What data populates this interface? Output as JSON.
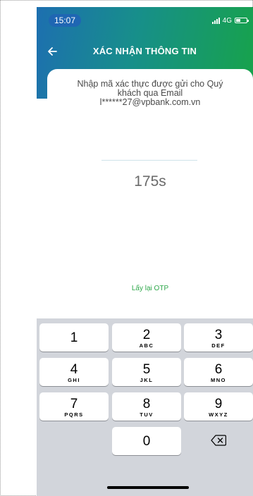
{
  "status_bar": {
    "time": "15:07",
    "network": "4G"
  },
  "header": {
    "title": "XÁC NHẬN THÔNG TIN"
  },
  "content": {
    "message_line1": "Nhập mã xác thực được gửi cho Quý",
    "message_line2": "khách qua Email",
    "message_line3": "l******27@vpbank.com.vn",
    "countdown": "175s",
    "resend_label": "Lấy lại OTP"
  },
  "keypad": {
    "keys": [
      {
        "digit": "1",
        "letters": ""
      },
      {
        "digit": "2",
        "letters": "ABC"
      },
      {
        "digit": "3",
        "letters": "DEF"
      },
      {
        "digit": "4",
        "letters": "GHI"
      },
      {
        "digit": "5",
        "letters": "JKL"
      },
      {
        "digit": "6",
        "letters": "MNO"
      },
      {
        "digit": "7",
        "letters": "PQRS"
      },
      {
        "digit": "8",
        "letters": "TUV"
      },
      {
        "digit": "9",
        "letters": "WXYZ"
      },
      {
        "digit": "0",
        "letters": ""
      }
    ]
  },
  "colors": {
    "header_blue": "#1d6fb0",
    "header_green": "#17a34a",
    "link_green": "#2ea84a",
    "keyboard_bg": "#d2d5db"
  },
  "icons": {
    "back": "arrow-left-icon",
    "delete": "backspace-icon"
  }
}
